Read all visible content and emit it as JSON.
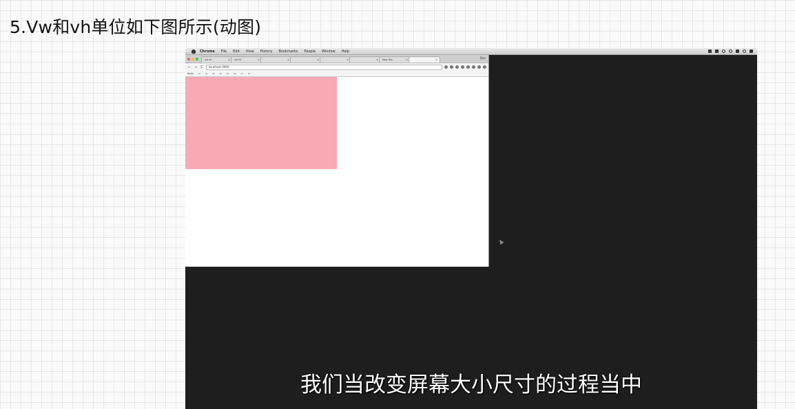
{
  "slide": {
    "title": "5.Vw和vh单位如下图所示(动图)"
  },
  "menubar": {
    "items": [
      "Chrome",
      "File",
      "Edit",
      "View",
      "History",
      "Bookmarks",
      "People",
      "Window",
      "Help"
    ]
  },
  "browser": {
    "tabs": [
      {
        "label": "vw vh",
        "active": false
      },
      {
        "label": "vw vh",
        "active": false
      },
      {
        "label": "",
        "active": false
      },
      {
        "label": "",
        "active": false
      },
      {
        "label": "",
        "active": false
      },
      {
        "label": "",
        "active": false
      },
      {
        "label": "New Tab",
        "active": false
      },
      {
        "label": "",
        "active": true
      }
    ],
    "url": "localhost:3000",
    "bookmarks": [
      "Apps",
      "",
      "",
      "",
      "",
      "",
      "",
      "",
      ""
    ]
  },
  "colors": {
    "box": "#f7a9b4",
    "screen_bg": "#1e1e1e",
    "grid_line": "#e6e6e6"
  },
  "subtitle": "我们当改变屏幕大小尺寸的过程当中"
}
